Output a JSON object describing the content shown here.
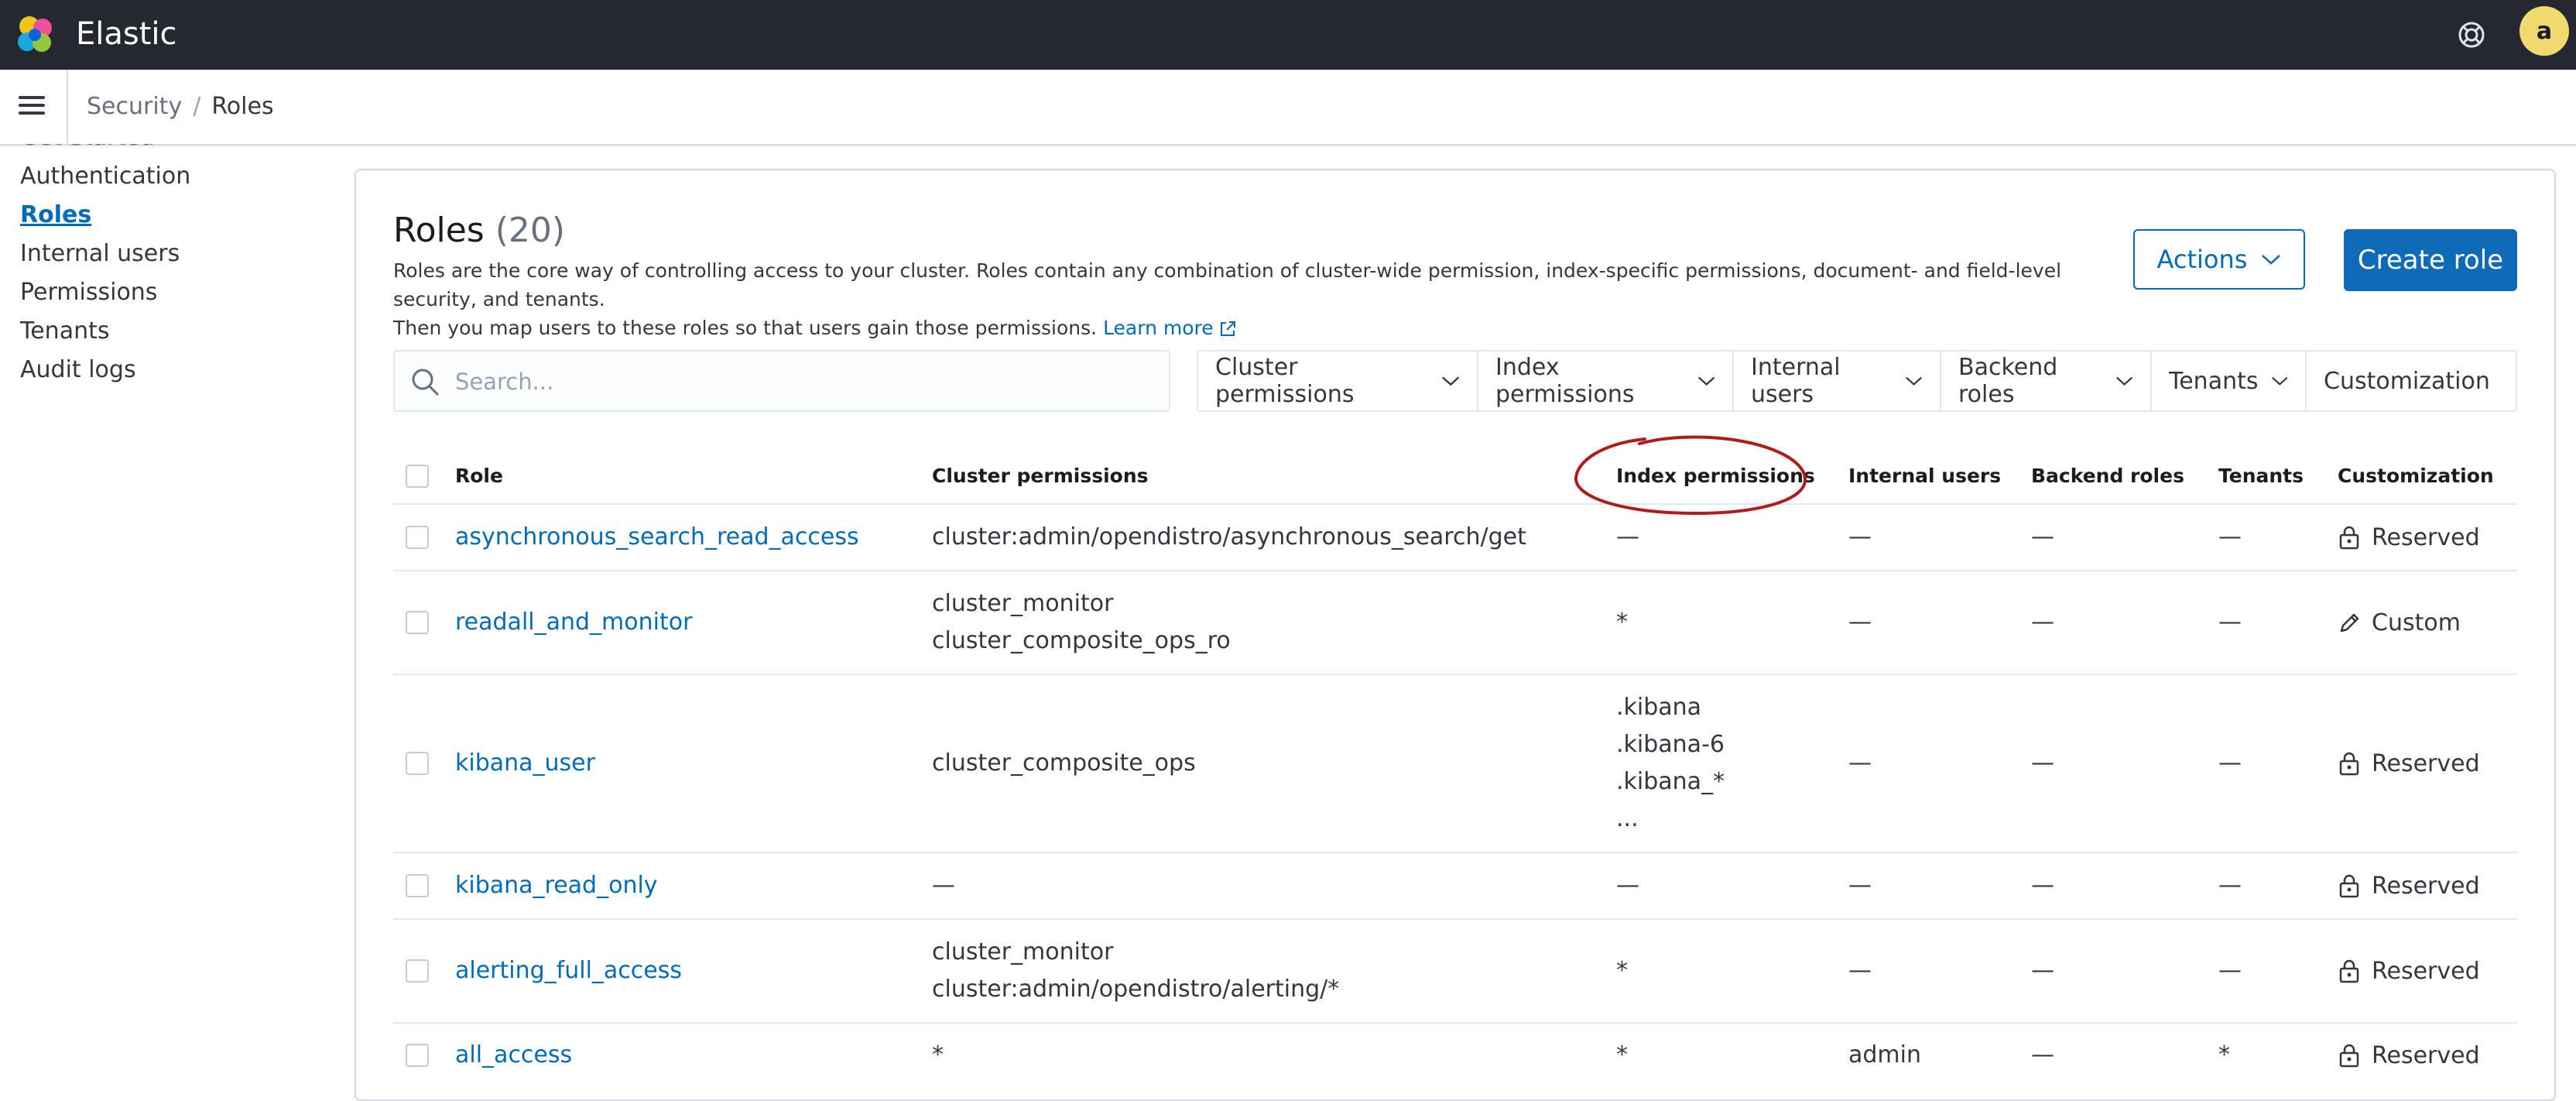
{
  "header": {
    "brand": "Elastic",
    "avatar_initial": "a"
  },
  "breadcrumb": {
    "parent": "Security",
    "separator": "/",
    "current": "Roles"
  },
  "sidenav": {
    "clipped_item": "Get Started",
    "items": [
      {
        "label": "Authentication",
        "active": false
      },
      {
        "label": "Roles",
        "active": true
      },
      {
        "label": "Internal users",
        "active": false
      },
      {
        "label": "Permissions",
        "active": false
      },
      {
        "label": "Tenants",
        "active": false
      },
      {
        "label": "Audit logs",
        "active": false
      }
    ]
  },
  "page": {
    "title": "Roles",
    "count": "(20)",
    "description_line1": "Roles are the core way of controlling access to your cluster. Roles contain any combination of cluster-wide permission, index-specific permissions, document- and field-level security, and tenants.",
    "description_line2": "Then you map users to these roles so that users gain those permissions.",
    "learn_more": "Learn more",
    "actions_label": "Actions",
    "create_label": "Create role"
  },
  "search": {
    "placeholder": "Search..."
  },
  "filters": [
    {
      "label": "Cluster permissions"
    },
    {
      "label": "Index permissions"
    },
    {
      "label": "Internal users"
    },
    {
      "label": "Backend roles"
    },
    {
      "label": "Tenants"
    },
    {
      "label": "Customization"
    }
  ],
  "table": {
    "columns": {
      "role": "Role",
      "cluster": "Cluster permissions",
      "index": "Index permissions",
      "users": "Internal users",
      "backend": "Backend roles",
      "tenants": "Tenants",
      "custom": "Customization"
    },
    "rows": [
      {
        "role": "asynchronous_search_read_access",
        "cluster": [
          "cluster:admin/opendistro/asynchronous_search/get"
        ],
        "index": [
          "—"
        ],
        "users": "—",
        "backend": "—",
        "tenants": "—",
        "custom": "Reserved",
        "custom_icon": "lock-icon"
      },
      {
        "role": "readall_and_monitor",
        "cluster": [
          "cluster_monitor",
          "cluster_composite_ops_ro"
        ],
        "index": [
          "*"
        ],
        "users": "—",
        "backend": "—",
        "tenants": "—",
        "custom": "Custom",
        "custom_icon": "pencil-icon"
      },
      {
        "role": "kibana_user",
        "cluster": [
          "cluster_composite_ops"
        ],
        "index": [
          ".kibana",
          ".kibana-6",
          ".kibana_*",
          "..."
        ],
        "users": "—",
        "backend": "—",
        "tenants": "—",
        "custom": "Reserved",
        "custom_icon": "lock-icon"
      },
      {
        "role": "kibana_read_only",
        "cluster": [
          "—"
        ],
        "index": [
          "—"
        ],
        "users": "—",
        "backend": "—",
        "tenants": "—",
        "custom": "Reserved",
        "custom_icon": "lock-icon"
      },
      {
        "role": "alerting_full_access",
        "cluster": [
          "cluster_monitor",
          "cluster:admin/opendistro/alerting/*"
        ],
        "index": [
          "*"
        ],
        "users": "—",
        "backend": "—",
        "tenants": "—",
        "custom": "Reserved",
        "custom_icon": "lock-icon"
      },
      {
        "role": "all_access",
        "cluster": [
          "*"
        ],
        "index": [
          "*"
        ],
        "users": "admin",
        "backend": "—",
        "tenants": "*",
        "custom": "Reserved",
        "custom_icon": "lock-icon"
      }
    ]
  },
  "colors": {
    "header_bg": "#25282f",
    "link": "#006bb8",
    "primary_button": "#0f6bb8",
    "annotation": "#b01c1c"
  }
}
